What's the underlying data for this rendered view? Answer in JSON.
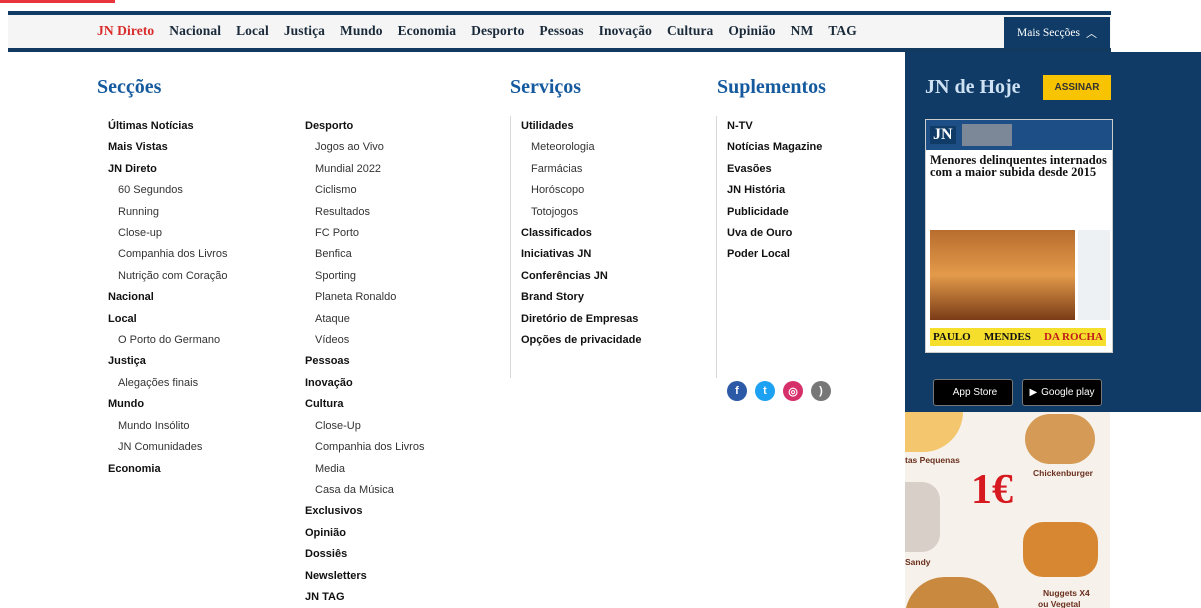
{
  "topnav": {
    "items": [
      "JN Direto",
      "Nacional",
      "Local",
      "Justiça",
      "Mundo",
      "Economia",
      "Desporto",
      "Pessoas",
      "Inovação",
      "Cultura",
      "Opinião",
      "NM",
      "TAG"
    ],
    "more_label": "Mais Secções"
  },
  "menu": {
    "seccoes_title": "Secções",
    "servicos_title": "Serviços",
    "suplementos_title": "Suplementos",
    "col1": [
      {
        "label": "Últimas Notícias",
        "bold": true
      },
      {
        "label": "Mais Vistas",
        "bold": true
      },
      {
        "label": "JN Direto",
        "bold": true
      },
      {
        "label": "60 Segundos",
        "bold": false
      },
      {
        "label": "Running",
        "bold": false
      },
      {
        "label": "Close-up",
        "bold": false
      },
      {
        "label": "Companhia dos Livros",
        "bold": false
      },
      {
        "label": "Nutrição com Coração",
        "bold": false
      },
      {
        "label": "Nacional",
        "bold": true
      },
      {
        "label": "Local",
        "bold": true
      },
      {
        "label": "O Porto do Germano",
        "bold": false
      },
      {
        "label": "Justiça",
        "bold": true
      },
      {
        "label": "Alegações finais",
        "bold": false
      },
      {
        "label": "Mundo",
        "bold": true
      },
      {
        "label": "Mundo Insólito",
        "bold": false
      },
      {
        "label": "JN Comunidades",
        "bold": false
      },
      {
        "label": "Economia",
        "bold": true
      }
    ],
    "col2": [
      {
        "label": "Desporto",
        "bold": true
      },
      {
        "label": "Jogos ao Vivo",
        "bold": false
      },
      {
        "label": "Mundial 2022",
        "bold": false
      },
      {
        "label": "Ciclismo",
        "bold": false
      },
      {
        "label": "Resultados",
        "bold": false
      },
      {
        "label": "FC Porto",
        "bold": false
      },
      {
        "label": "Benfica",
        "bold": false
      },
      {
        "label": "Sporting",
        "bold": false
      },
      {
        "label": "Planeta Ronaldo",
        "bold": false
      },
      {
        "label": "Ataque",
        "bold": false
      },
      {
        "label": "Vídeos",
        "bold": false
      },
      {
        "label": "Pessoas",
        "bold": true
      },
      {
        "label": "Inovação",
        "bold": true
      },
      {
        "label": "Cultura",
        "bold": true
      },
      {
        "label": "Close-Up",
        "bold": false
      },
      {
        "label": "Companhia dos Livros",
        "bold": false
      },
      {
        "label": "Media",
        "bold": false
      },
      {
        "label": "Casa da Música",
        "bold": false
      },
      {
        "label": "Exclusivos",
        "bold": true
      },
      {
        "label": "Opinião",
        "bold": true
      },
      {
        "label": "Dossiês",
        "bold": true
      },
      {
        "label": "Newsletters",
        "bold": true
      },
      {
        "label": "JN TAG",
        "bold": true
      }
    ],
    "servicos": [
      {
        "label": "Utilidades",
        "bold": true
      },
      {
        "label": "Meteorologia",
        "bold": false
      },
      {
        "label": "Farmácias",
        "bold": false
      },
      {
        "label": "Horóscopo",
        "bold": false
      },
      {
        "label": "Totojogos",
        "bold": false
      },
      {
        "label": "Classificados",
        "bold": true
      },
      {
        "label": "Iniciativas JN",
        "bold": true
      },
      {
        "label": "Conferências JN",
        "bold": true
      },
      {
        "label": "Brand Story",
        "bold": true
      },
      {
        "label": "Diretório de Empresas",
        "bold": true
      },
      {
        "label": "Opções de privacidade",
        "bold": true
      }
    ],
    "suplementos": [
      {
        "label": "N-TV",
        "bold": true
      },
      {
        "label": "Notícias Magazine",
        "bold": true
      },
      {
        "label": "Evasões",
        "bold": true
      },
      {
        "label": "JN História",
        "bold": true
      },
      {
        "label": "Publicidade",
        "bold": true
      },
      {
        "label": "Uva de Ouro",
        "bold": true
      },
      {
        "label": "Poder Local",
        "bold": true
      }
    ],
    "social": [
      {
        "icon": "facebook-icon",
        "glyph": "f",
        "color": "#2d5aa6"
      },
      {
        "icon": "twitter-icon",
        "glyph": "t",
        "color": "#1da1f2"
      },
      {
        "icon": "instagram-icon",
        "glyph": "◎",
        "color": "#d6306b"
      },
      {
        "icon": "rss-icon",
        "glyph": ")",
        "color": "#777777"
      }
    ]
  },
  "today": {
    "title": "JN de Hoje",
    "subscribe_label": "ASSINAR",
    "cover_logo": "JN",
    "cover_headline": "Menores delinquentes internados com a maior subida desde 2015",
    "cover_banner_left": "PAULO",
    "cover_banner_mid": "MENDES",
    "cover_banner_right": "DA ROCHA",
    "appstore_label": "App Store",
    "googleplay_label": "Google play"
  },
  "ad": {
    "label1": "tas Pequenas",
    "label2": "Chickenburger",
    "price": "1€",
    "label3": "Sandy",
    "label4": "Nuggets X4",
    "label5": "ou Vegetal"
  }
}
